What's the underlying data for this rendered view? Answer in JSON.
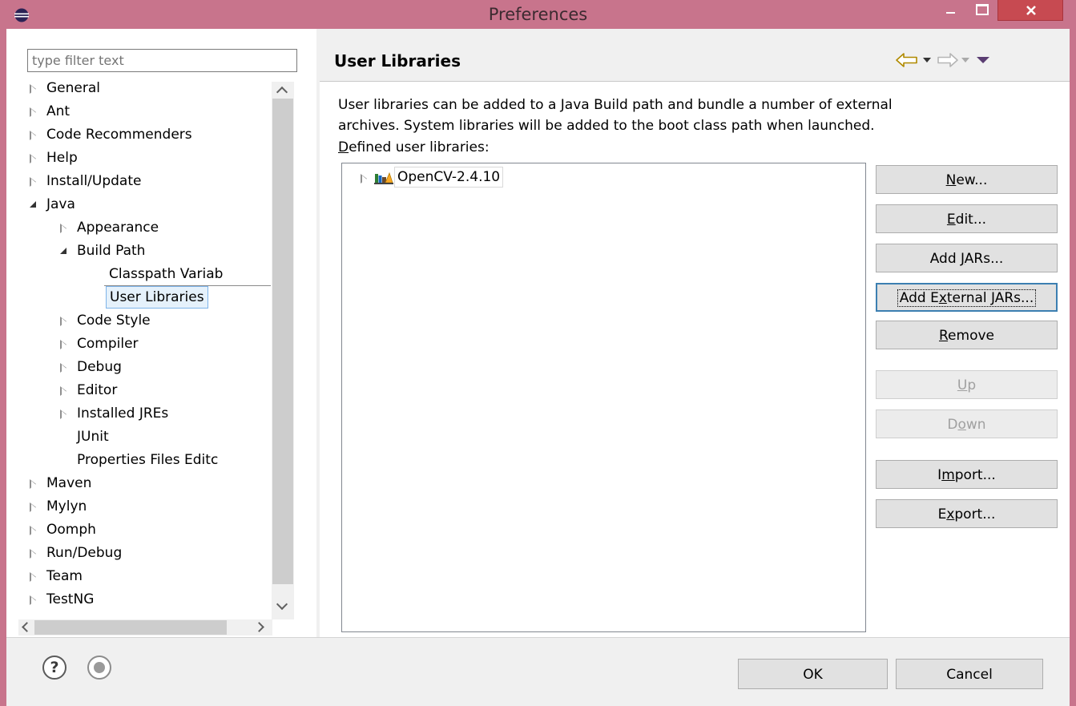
{
  "window": {
    "title": "Preferences",
    "icon": "eclipse-icon",
    "close_color": "#c74a51",
    "frame_color": "#c8748c"
  },
  "left": {
    "filter_placeholder": "type filter text",
    "tree": [
      {
        "label": "General",
        "twisty": "collapsed",
        "level": 0
      },
      {
        "label": "Ant",
        "twisty": "collapsed",
        "level": 0
      },
      {
        "label": "Code Recommenders",
        "twisty": "collapsed",
        "level": 0
      },
      {
        "label": "Help",
        "twisty": "collapsed",
        "level": 0
      },
      {
        "label": "Install/Update",
        "twisty": "collapsed",
        "level": 0
      },
      {
        "label": "Java",
        "twisty": "expanded",
        "level": 0
      },
      {
        "label": "Appearance",
        "twisty": "collapsed",
        "level": 1
      },
      {
        "label": "Build Path",
        "twisty": "expanded",
        "level": 1
      },
      {
        "label": "Classpath Variab",
        "twisty": "none",
        "level": 2
      },
      {
        "label": "User Libraries",
        "twisty": "none",
        "level": 2,
        "selected": true
      },
      {
        "label": "Code Style",
        "twisty": "collapsed",
        "level": 1
      },
      {
        "label": "Compiler",
        "twisty": "collapsed",
        "level": 1
      },
      {
        "label": "Debug",
        "twisty": "collapsed",
        "level": 1
      },
      {
        "label": "Editor",
        "twisty": "collapsed",
        "level": 1
      },
      {
        "label": "Installed JREs",
        "twisty": "collapsed",
        "level": 1
      },
      {
        "label": "JUnit",
        "twisty": "none",
        "level": 1
      },
      {
        "label": "Properties Files Editc",
        "twisty": "none",
        "level": 1
      },
      {
        "label": "Maven",
        "twisty": "collapsed",
        "level": 0
      },
      {
        "label": "Mylyn",
        "twisty": "collapsed",
        "level": 0
      },
      {
        "label": "Oomph",
        "twisty": "collapsed",
        "level": 0
      },
      {
        "label": "Run/Debug",
        "twisty": "collapsed",
        "level": 0
      },
      {
        "label": "Team",
        "twisty": "collapsed",
        "level": 0
      },
      {
        "label": "TestNG",
        "twisty": "collapsed",
        "level": 0
      }
    ]
  },
  "page": {
    "title": "User Libraries",
    "description_line1": "User libraries can be added to a Java Build path and bundle a number of external",
    "description_line2": "archives. System libraries will be added to the boot class path when launched.",
    "defined_label_mnemonic": "D",
    "defined_label_rest": "efined user libraries:",
    "libraries": [
      {
        "label": "OpenCV-2.4.10",
        "icon": "library-icon"
      }
    ]
  },
  "buttons": [
    {
      "name": "new-button",
      "pre": "",
      "mnemonic": "N",
      "post": "ew...",
      "enabled": true
    },
    {
      "name": "edit-button",
      "pre": "",
      "mnemonic": "E",
      "post": "dit...",
      "enabled": true
    },
    {
      "name": "add-jars-button",
      "pre": "Add ",
      "mnemonic": "J",
      "post": "ARs...",
      "enabled": true
    },
    {
      "name": "add-external-jars-button",
      "pre": "Add E",
      "mnemonic": "x",
      "post": "ternal JARs...",
      "enabled": true,
      "focused": true
    },
    {
      "name": "remove-button",
      "pre": "",
      "mnemonic": "R",
      "post": "emove",
      "enabled": true
    },
    {
      "name": "up-button",
      "pre": "",
      "mnemonic": "U",
      "post": "p",
      "enabled": false
    },
    {
      "name": "down-button",
      "pre": "D",
      "mnemonic": "o",
      "post": "wn",
      "enabled": false
    },
    {
      "name": "import-button",
      "pre": "I",
      "mnemonic": "m",
      "post": "port...",
      "enabled": true
    },
    {
      "name": "export-button",
      "pre": "E",
      "mnemonic": "x",
      "post": "port...",
      "enabled": true
    }
  ],
  "footer": {
    "help_glyph": "?",
    "ok_label": "OK",
    "cancel_label": "Cancel"
  }
}
